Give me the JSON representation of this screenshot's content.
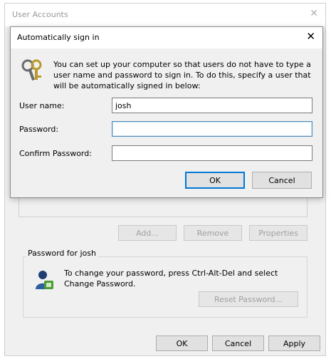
{
  "background_window": {
    "title": "User Accounts",
    "buttons": {
      "add": "Add...",
      "remove": "Remove",
      "properties": "Properties"
    },
    "password_group": {
      "label": "Password for josh",
      "text": "To change your password, press Ctrl-Alt-Del and select Change Password.",
      "reset_button": "Reset Password..."
    },
    "footer": {
      "ok": "OK",
      "cancel": "Cancel",
      "apply": "Apply"
    }
  },
  "dialog": {
    "title": "Automatically sign in",
    "description": "You can set up your computer so that users do not have to type a user name and password to sign in. To do this, specify a user that will be automatically signed in below:",
    "fields": {
      "username": {
        "label": "User name:",
        "value": "josh"
      },
      "password": {
        "label": "Password:",
        "value": ""
      },
      "confirm": {
        "label": "Confirm Password:",
        "value": ""
      }
    },
    "buttons": {
      "ok": "OK",
      "cancel": "Cancel"
    }
  },
  "icons": {
    "dialog_close": "close-icon",
    "background_close": "close-icon",
    "keys": "keys-icon",
    "user": "user-icon"
  }
}
